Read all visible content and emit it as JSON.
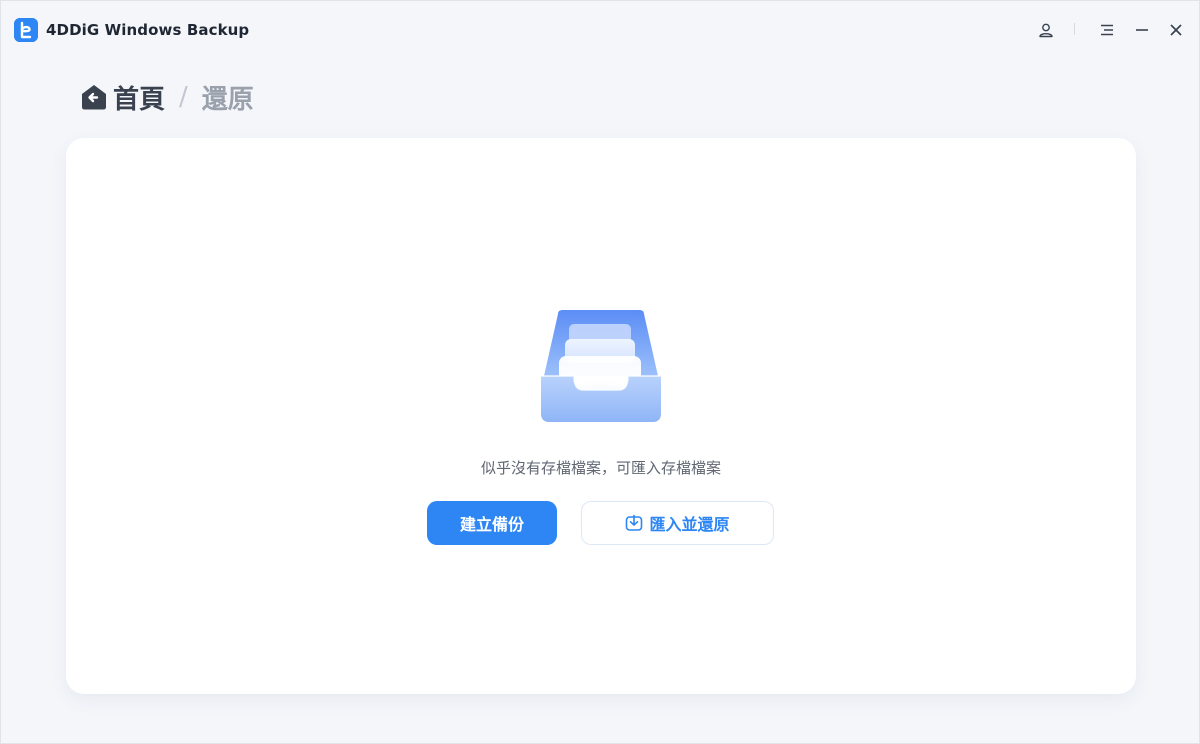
{
  "app": {
    "title": "4DDiG Windows Backup"
  },
  "breadcrumb": {
    "home": "首頁",
    "separator": "/",
    "current": "還原"
  },
  "empty_state": {
    "message": "似乎沒有存檔檔案，可匯入存檔檔案",
    "create_backup_label": "建立備份",
    "import_restore_label": "匯入並還原"
  },
  "icons": {
    "account": "user-icon",
    "menu": "menu-icon",
    "minimize": "minimize-icon",
    "close": "close-icon",
    "home": "home-back-icon",
    "import": "import-download-icon",
    "illustration": "empty-inbox-icon"
  },
  "colors": {
    "accent": "#2d86f4",
    "background": "#f4f6fa",
    "card": "#ffffff"
  }
}
